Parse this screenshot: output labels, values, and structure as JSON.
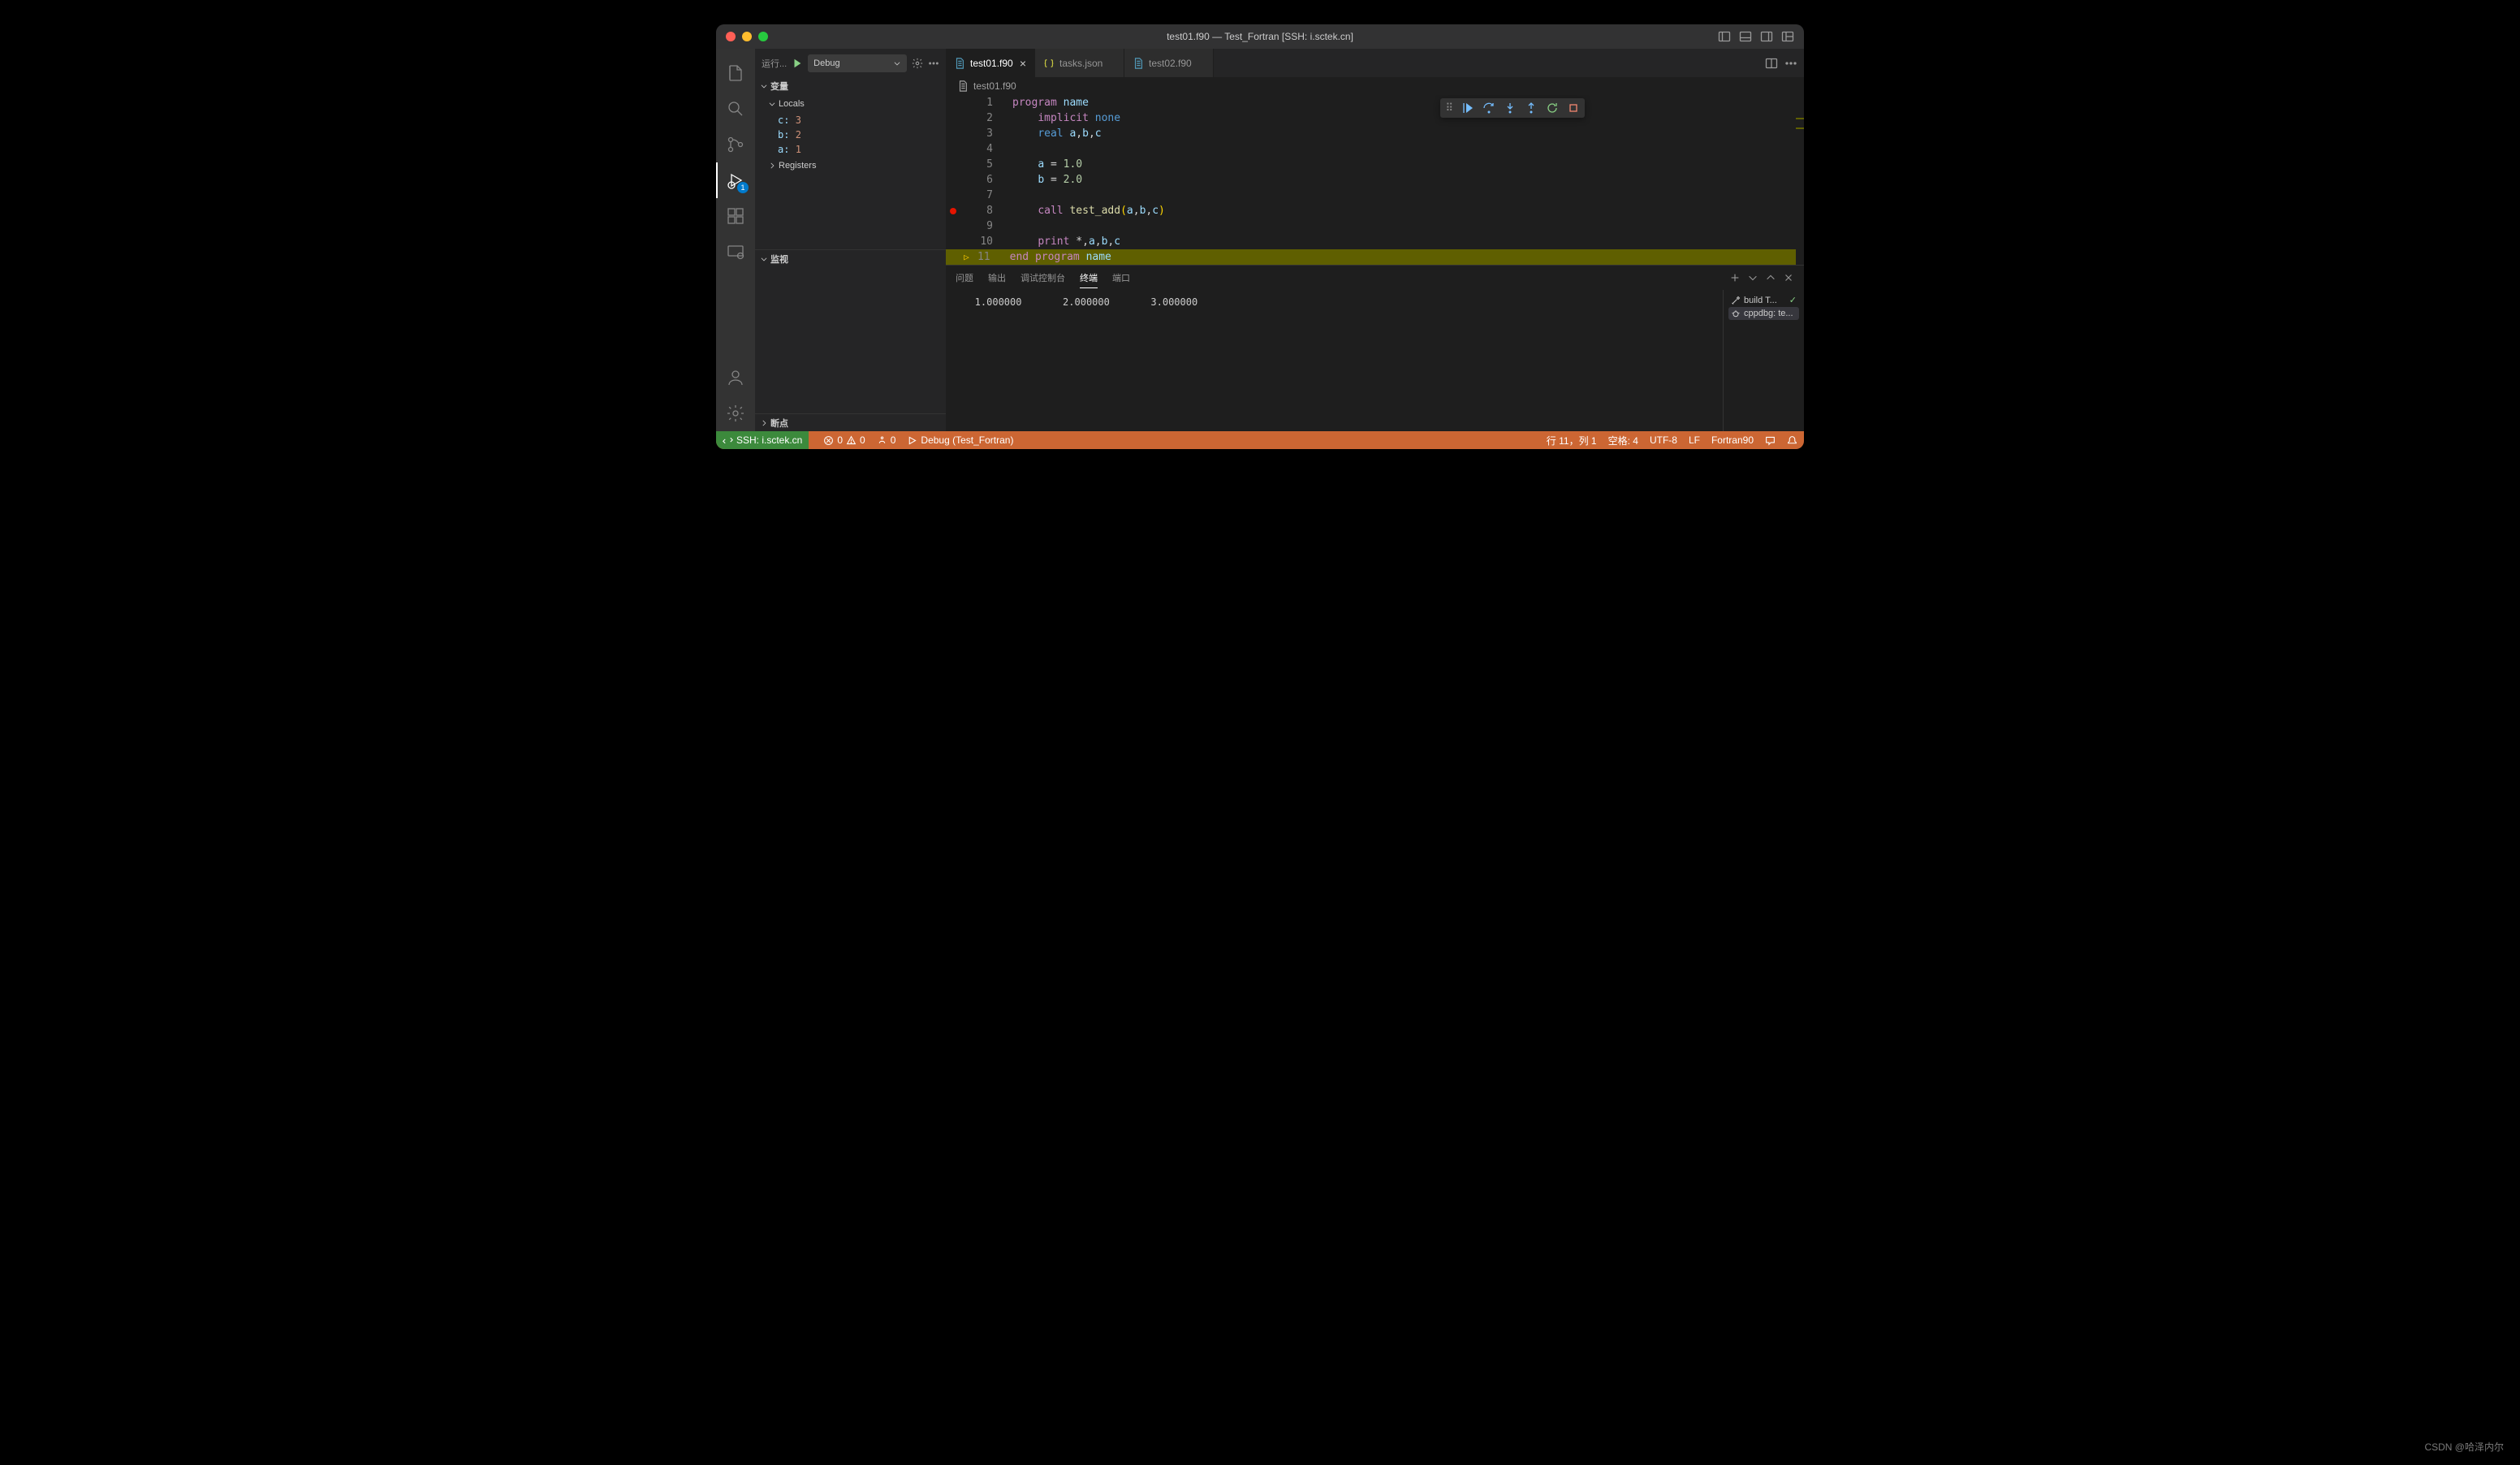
{
  "window": {
    "title": "test01.f90 — Test_Fortran [SSH: i.sctek.cn]"
  },
  "sidebar": {
    "run_label": "运行...",
    "config": "Debug",
    "section_variables": "变量",
    "section_locals": "Locals",
    "vars": [
      {
        "name": "c:",
        "value": "3"
      },
      {
        "name": "b:",
        "value": "2"
      },
      {
        "name": "a:",
        "value": "1"
      }
    ],
    "section_registers": "Registers",
    "section_watch": "监视",
    "section_breakpoints": "断点"
  },
  "activitybar": {
    "debug_badge": "1"
  },
  "tabs": [
    {
      "label": "test01.f90",
      "active": true,
      "closable": true,
      "kind": "file"
    },
    {
      "label": "tasks.json",
      "active": false,
      "closable": false,
      "kind": "json"
    },
    {
      "label": "test02.f90",
      "active": false,
      "closable": false,
      "kind": "file"
    }
  ],
  "breadcrumb": "test01.f90",
  "code": {
    "lines": [
      {
        "n": 1,
        "html": "<span class='kw'>program</span> <span class='id'>name</span>"
      },
      {
        "n": 2,
        "html": "    <span class='kw'>implicit</span> <span class='type'>none</span>"
      },
      {
        "n": 3,
        "html": "    <span class='type'>real</span> <span class='id'>a</span><span class='op'>,</span><span class='id'>b</span><span class='op'>,</span><span class='id'>c</span>"
      },
      {
        "n": 4,
        "html": ""
      },
      {
        "n": 5,
        "html": "    <span class='id'>a</span> <span class='op'>=</span> <span class='num'>1.0</span>"
      },
      {
        "n": 6,
        "html": "    <span class='id'>b</span> <span class='op'>=</span> <span class='num'>2.0</span>"
      },
      {
        "n": 7,
        "html": ""
      },
      {
        "n": 8,
        "html": "    <span class='kw'>call</span> <span class='fn'>test_add</span><span class='paren'>(</span><span class='id'>a</span><span class='op'>,</span><span class='id'>b</span><span class='op'>,</span><span class='id'>c</span><span class='paren'>)</span>",
        "bp": true
      },
      {
        "n": 9,
        "html": ""
      },
      {
        "n": 10,
        "html": "    <span class='kw'>print</span> <span class='op'>*,</span><span class='id'>a</span><span class='op'>,</span><span class='id'>b</span><span class='op'>,</span><span class='id'>c</span>"
      },
      {
        "n": 11,
        "html": "<span class='kw'>end</span> <span class='kw'>program</span> <span class='id'>name</span>",
        "current": true
      }
    ]
  },
  "panel": {
    "tabs": {
      "problems": "问题",
      "output": "输出",
      "debug_console": "调试控制台",
      "terminal": "终端",
      "ports": "端口"
    },
    "terminal_output": "   1.000000       2.000000       3.000000",
    "term_items": [
      {
        "label": "build T...",
        "check": true,
        "icon": "tools"
      },
      {
        "label": "cppdbg: te...",
        "check": false,
        "icon": "bug",
        "active": true
      }
    ]
  },
  "statusbar": {
    "remote": "SSH: i.sctek.cn",
    "errors": "0",
    "warnings": "0",
    "ports": "0",
    "debug": "Debug (Test_Fortran)",
    "cursor": "行 11，列 1",
    "spaces": "空格: 4",
    "encoding": "UTF-8",
    "eol": "LF",
    "lang": "Fortran90"
  },
  "watermark": "CSDN @哈泽内尔"
}
